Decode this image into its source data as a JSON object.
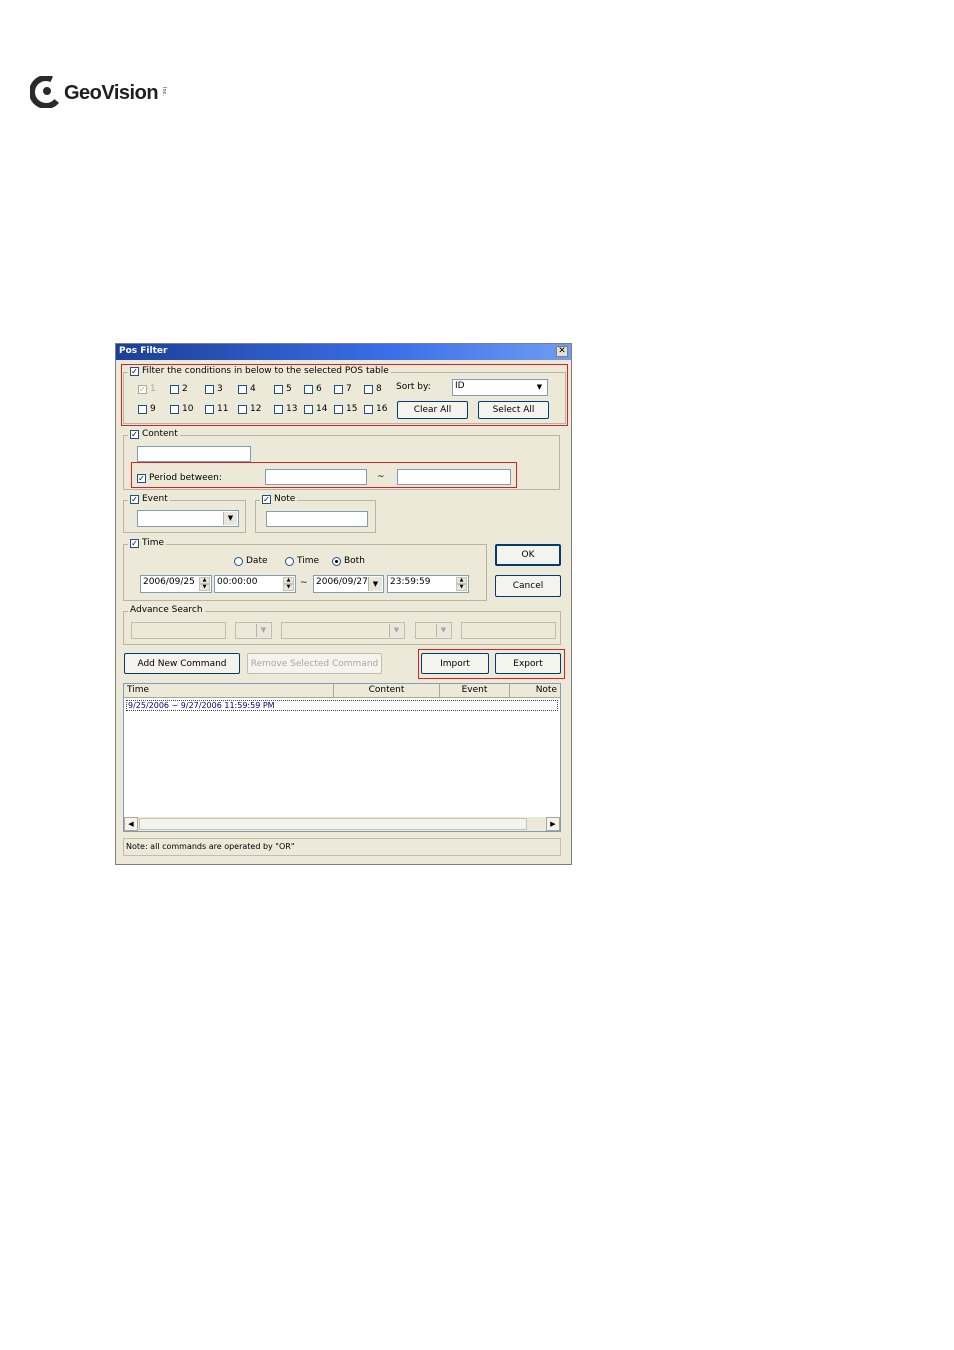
{
  "logo": {
    "text": "GeoVision",
    "sub": "Inc."
  },
  "dialog": {
    "title": "Pos Filter",
    "close_glyph": "✕",
    "filter_group": {
      "label": "Filter the conditions in below to the selected POS table",
      "checked": true,
      "channels": [
        "1",
        "2",
        "3",
        "4",
        "5",
        "6",
        "7",
        "8",
        "9",
        "10",
        "11",
        "12",
        "13",
        "14",
        "15",
        "16"
      ],
      "sort_by_label": "Sort by:",
      "sort_by_value": "ID",
      "clear_all": "Clear All",
      "select_all": "Select All"
    },
    "content_group": {
      "label": "Content",
      "value": "",
      "period_label": "Period between:",
      "period_from": "",
      "tilde": "~",
      "period_to": ""
    },
    "event_group": {
      "label": "Event",
      "value": ""
    },
    "note_group": {
      "label": "Note",
      "value": ""
    },
    "time_group": {
      "label": "Time",
      "radio_date": "Date",
      "radio_time": "Time",
      "radio_both": "Both",
      "start_date": "2006/09/25",
      "start_time": "00:00:00",
      "dash": "~",
      "end_date": "2006/09/27",
      "end_time": "23:59:59"
    },
    "ok_label": "OK",
    "cancel_label": "Cancel",
    "advance_group": {
      "label": "Advance Search"
    },
    "add_command": "Add New Command",
    "remove_command": "Remove Selected Command",
    "import_label": "Import",
    "export_label": "Export",
    "list": {
      "columns": [
        "Time",
        "Content",
        "Event",
        "Note"
      ],
      "rows": [
        "9/25/2006 ~ 9/27/2006 11:59:59 PM"
      ]
    },
    "status_note": "Note: all commands are operated by \"OR\""
  },
  "colors": {
    "highlight": "#e0201c",
    "titlebar": "#1c3f95",
    "row_text": "#000080"
  }
}
